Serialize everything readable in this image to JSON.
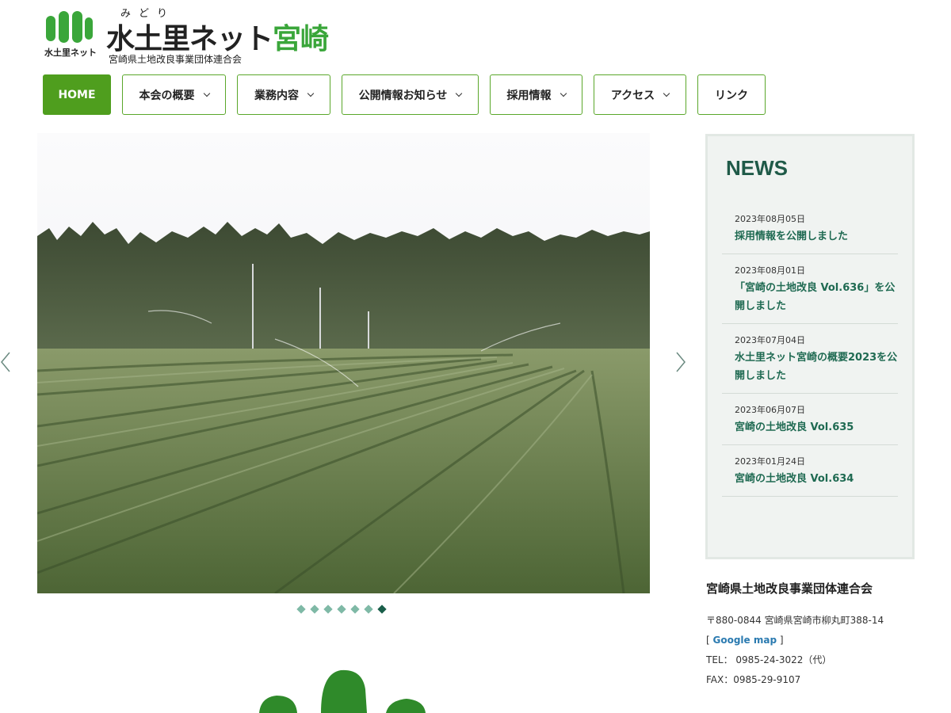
{
  "logo": {
    "ruby": "みどり",
    "title_main": "水土里ネット",
    "title_accent": "宮崎",
    "subtitle": "宮崎県土地改良事業団体連合会",
    "mark_caption": "水土里ネット"
  },
  "nav": {
    "items": [
      {
        "label": "HOME",
        "active": true,
        "dropdown": false
      },
      {
        "label": "本会の概要",
        "dropdown": true
      },
      {
        "label": "業務内容",
        "dropdown": true
      },
      {
        "label": "公開情報お知らせ",
        "dropdown": true
      },
      {
        "label": "採用情報",
        "dropdown": true
      },
      {
        "label": "アクセス",
        "dropdown": true
      },
      {
        "label": "リンク",
        "dropdown": false
      }
    ]
  },
  "slider": {
    "slide_count": 7,
    "active_index": 6
  },
  "news": {
    "title": "NEWS",
    "items": [
      {
        "date": "2023年08月05日",
        "text": "採用情報を公開しました"
      },
      {
        "date": "2023年08月01日",
        "text": "「宮崎の土地改良 Vol.636」を公開しました"
      },
      {
        "date": "2023年07月04日",
        "text": "水土里ネット宮崎の概要2023を公開しました"
      },
      {
        "date": "2023年06月07日",
        "text": "宮崎の土地改良 Vol.635"
      },
      {
        "date": "2023年01月24日",
        "text": "宮崎の土地改良 Vol.634"
      }
    ]
  },
  "org": {
    "name": "宮崎県土地改良事業団体連合会",
    "address": "〒880-0844 宮崎県宮崎市柳丸町388-14",
    "map_prefix": "[ ",
    "map_link": "Google map",
    "map_suffix": " ]",
    "tel": "TEL： 0985-24-3022（代）",
    "fax": "FAX：0985-29-9107"
  },
  "colors": {
    "brand_green": "#4f9e1e",
    "news_title": "#1f5a48",
    "news_link": "#1f6a52",
    "dot": "#7fb9a6",
    "dot_active": "#1a5e4a"
  }
}
